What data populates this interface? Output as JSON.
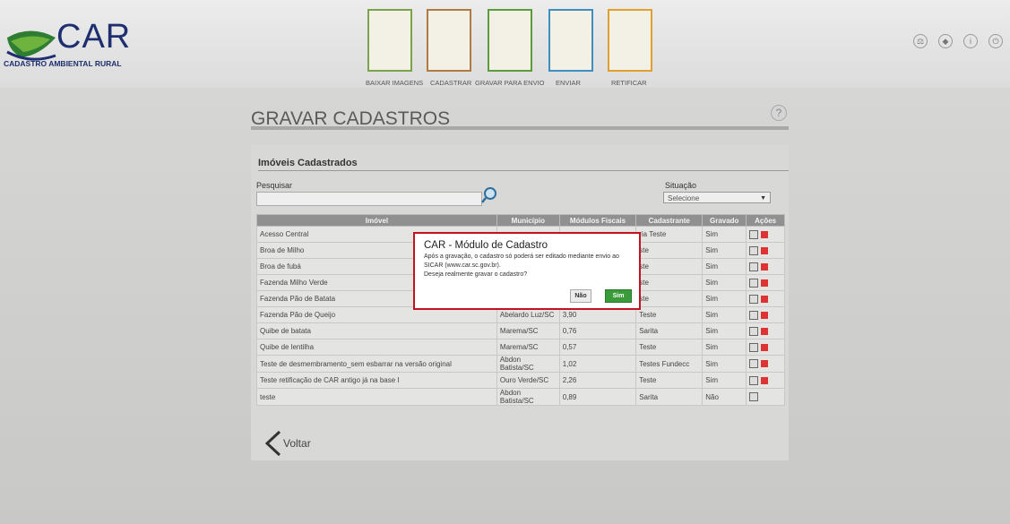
{
  "app": {
    "logo_text": "CAR",
    "logo_subtitle": "CADASTRO AMBIENTAL RURAL"
  },
  "steps": [
    {
      "label": "BAIXAR IMAGENS",
      "color": "#7aa34a"
    },
    {
      "label": "CADASTRAR",
      "color": "#b07a43"
    },
    {
      "label": "GRAVAR PARA ENVIO",
      "color": "#5b9c3c"
    },
    {
      "label": "ENVIAR",
      "color": "#3e8fbf"
    },
    {
      "label": "RETIFICAR",
      "color": "#e0a030"
    }
  ],
  "page": {
    "title": "GRAVAR CADASTROS",
    "help": "?"
  },
  "panel": {
    "title": "Imóveis Cadastrados",
    "search_label": "Pesquisar",
    "situacao_label": "Situação",
    "situacao_value": "Selecione",
    "back_label": "Voltar"
  },
  "table": {
    "headers": [
      "Imóvel",
      "Município",
      "Módulos Fiscais",
      "Cadastrante",
      "Gravado",
      "Ações"
    ],
    "rows": [
      [
        "Acesso Central",
        "",
        "",
        "ria Teste",
        "Sim"
      ],
      [
        "Broa de Milho",
        "",
        "",
        "ste",
        "Sim"
      ],
      [
        "Broa de fubá",
        "",
        "",
        "ste",
        "Sim"
      ],
      [
        "Fazenda Milho Verde",
        "",
        "",
        "ste",
        "Sim"
      ],
      [
        "Fazenda Pão de Batata",
        "",
        "",
        "ste",
        "Sim"
      ],
      [
        "Fazenda Pão de Queijo",
        "Abelardo Luz/SC",
        "3,90",
        "Teste",
        "Sim"
      ],
      [
        "Quibe de batata",
        "Marema/SC",
        "0,76",
        "Sarita",
        "Sim"
      ],
      [
        "Quibe de lentilha",
        "Marema/SC",
        "0,57",
        "Teste",
        "Sim"
      ],
      [
        "Teste de desmembramento_sem esbarrar na versão original",
        "Abdon Batista/SC",
        "1,02",
        "Testes Fundecc",
        "Sim"
      ],
      [
        "Teste retificação de CAR antigo já na base I",
        "Ouro Verde/SC",
        "2,26",
        "Teste",
        "Sim"
      ],
      [
        "teste",
        "Abdon Batista/SC",
        "0,89",
        "Sarita",
        "Não"
      ]
    ]
  },
  "modal": {
    "title": "CAR - Módulo de Cadastro",
    "line1": "Após a gravação, o cadastro só poderá ser editado mediante envio ao",
    "line2": "SICAR (www.car.sc.gov.br).",
    "line3": "Deseja realmente gravar o cadastro?",
    "no_label": "Não",
    "yes_label": "Sim"
  }
}
